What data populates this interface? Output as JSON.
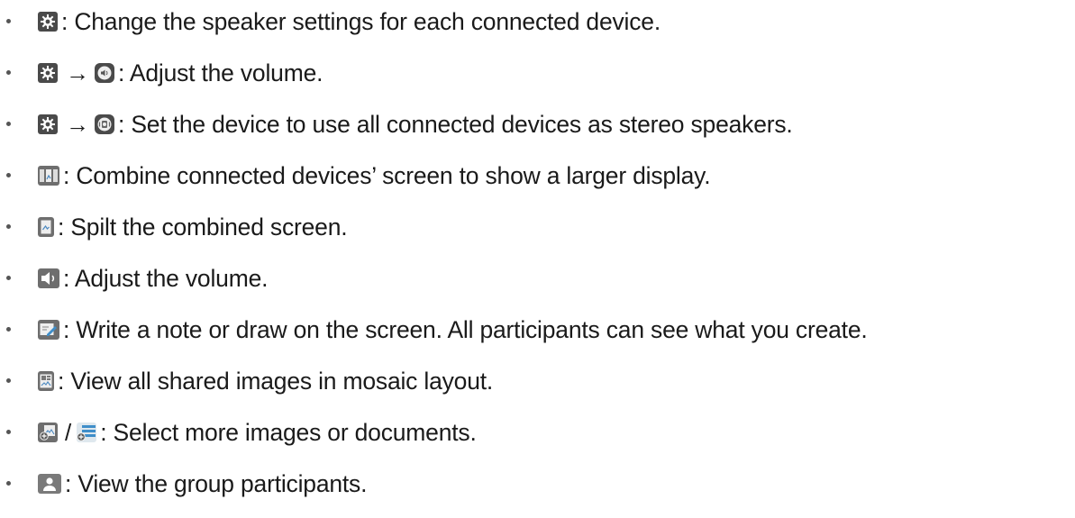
{
  "items": [
    {
      "icons": [
        "gear-icon"
      ],
      "text": ": Change the speaker settings for each connected device."
    },
    {
      "icons": [
        "gear-icon",
        "volume-circle-icon"
      ],
      "connector": "→",
      "text": ": Adjust the volume."
    },
    {
      "icons": [
        "gear-icon",
        "stereo-speaker-icon"
      ],
      "connector": "→",
      "text": ": Set the device to use all connected devices as stereo speakers."
    },
    {
      "icons": [
        "combine-screens-icon"
      ],
      "text": ": Combine connected devices’ screen to show a larger display."
    },
    {
      "icons": [
        "split-screen-icon"
      ],
      "text": ": Spilt the combined screen."
    },
    {
      "icons": [
        "speaker-icon"
      ],
      "text": ": Adjust the volume."
    },
    {
      "icons": [
        "pen-note-icon"
      ],
      "text": ": Write a note or draw on the screen. All participants can see what you create."
    },
    {
      "icons": [
        "mosaic-layout-icon"
      ],
      "text": ": View all shared images in mosaic layout."
    },
    {
      "icons": [
        "add-image-icon",
        "add-document-icon"
      ],
      "connector": "/",
      "text": ": Select more images or documents."
    },
    {
      "icons": [
        "participants-icon"
      ],
      "text": ": View the group participants."
    }
  ],
  "colors": {
    "text": "#1a1a1a",
    "icon_dark": "#4a4a4a",
    "icon_accent": "#3f8ec9"
  }
}
